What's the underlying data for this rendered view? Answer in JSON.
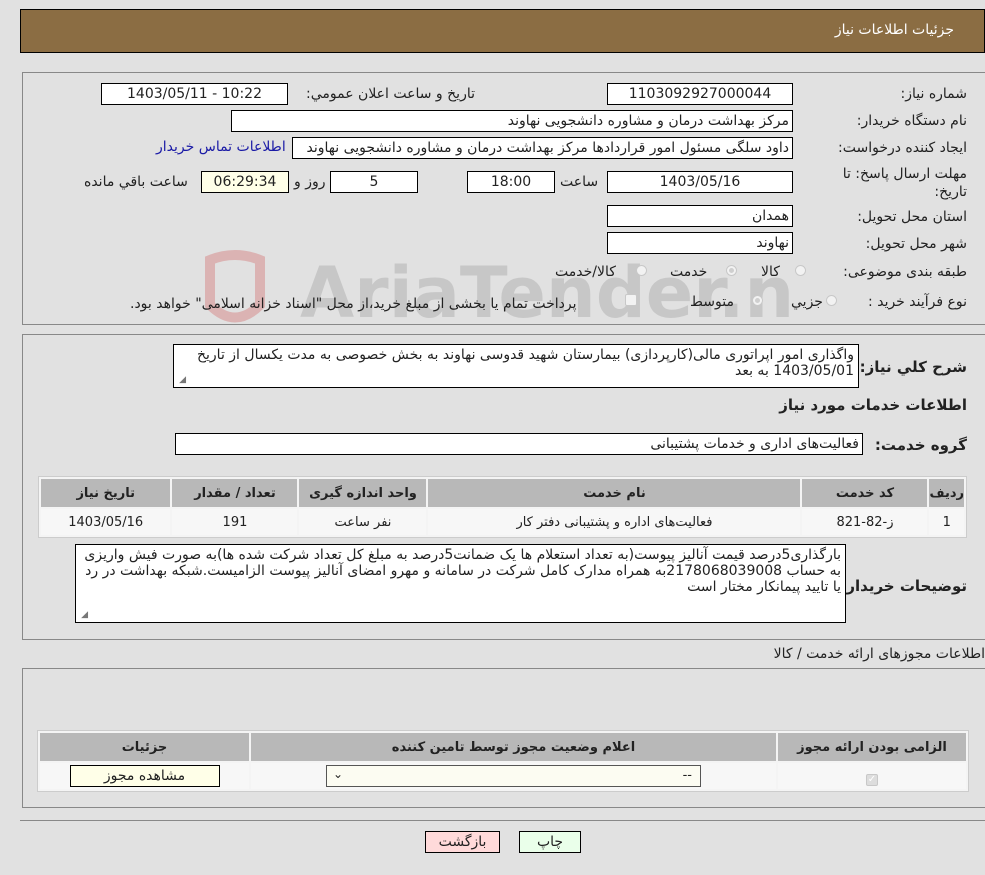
{
  "header": {
    "title": "جزئيات اطلاعات نياز"
  },
  "form": {
    "need_number_label": "شماره نياز:",
    "need_number": "1103092927000044",
    "announce_label": "تاريخ و ساعت اعلان عمومي:",
    "announce_value": "1403/05/11 - 10:22",
    "buyer_org_label": "نام دستگاه خريدار:",
    "buyer_org": "مرکز بهداشت  درمان و مشاوره دانشجویی نهاوند",
    "creator_label": "ايجاد کننده درخواست:",
    "creator": "داود سلگی مسئول امور قراردادها مرکز بهداشت  درمان و مشاوره دانشجویی نهاوند",
    "contact_link": "اطلاعات تماس خريدار",
    "deadline_label": "مهلت ارسال پاسخ: تا تاريخ:",
    "deadline_date": "1403/05/16",
    "time_label": "ساعت",
    "deadline_time": "18:00",
    "days_value": "5",
    "days_label": "روز و",
    "remaining_time": "06:29:34",
    "remaining_label": "ساعت باقي مانده",
    "province_label": "استان محل تحويل:",
    "province": "همدان",
    "city_label": "شهر محل تحويل:",
    "city": "نهاوند",
    "category_label": "طبقه بندی موضوعی:",
    "category_options": [
      "کالا",
      "خدمت",
      "کالا/خدمت"
    ],
    "category_selected": "خدمت",
    "process_label": "نوع فرآيند خريد :",
    "process_options": [
      "جزيي",
      "متوسط"
    ],
    "process_selected": "متوسط",
    "treasury_note": "پرداخت تمام يا بخشی از مبلغ خريد،از محل \"اسناد خزانه اسلامی\" خواهد بود.",
    "treasury_checked": false
  },
  "description": {
    "label": "شرح کلي نياز:",
    "text": "واگذاری امور اپراتوری مالی(کارپردازی) بیمارستان شهید قدوسی نهاوند به بخش خصوصی به مدت یکسال از تاریخ 1403/05/01 به بعد"
  },
  "services": {
    "section_title": "اطلاعات خدمات مورد نياز",
    "group_label": "گروه خدمت:",
    "group_value": "فعالیت‌های اداری و خدمات پشتیبانی",
    "columns": [
      "رديف",
      "کد خدمت",
      "نام خدمت",
      "واحد اندازه گيری",
      "تعداد / مقدار",
      "تاريخ نياز"
    ],
    "rows": [
      {
        "index": "1",
        "code": "ز-82-821",
        "name": "فعالیت‌های اداره و پشتیبانی دفتر کار",
        "unit": "نفر ساعت",
        "qty": "191",
        "date": "1403/05/16"
      }
    ]
  },
  "buyer_notes": {
    "label": "توضيحات خريدار:",
    "text": "بارگذاری5درصد قیمت آنالیز پیوست(به تعداد استعلام ها یک ضمانت5درصد به مبلغ کل تعداد شرکت شده ها)به صورت فیش واریزی به حساب 2178068039008به همراه مدارک کامل شرکت در سامانه و مهرو امضای آنالیز پیوست الزامیست.شبکه بهداشت در رد یا تایید پیمانکار مختار است"
  },
  "permits": {
    "section_title": "اطلاعات مجوزهای ارائه خدمت / کالا",
    "columns": [
      "الزامی بودن ارائه مجوز",
      "اعلام وضعيت مجوز توسط تامين کننده",
      "جزئيات"
    ],
    "row": {
      "required_checked": true,
      "status_value": "--",
      "view_button": "مشاهده مجوز"
    }
  },
  "footer": {
    "print_label": "چاپ",
    "back_label": "بازگشت"
  },
  "colors": {
    "header_bg": "#8b6d43",
    "print_bg": "#eaffea",
    "back_bg": "#ffdada",
    "link": "#1a1aa6"
  }
}
